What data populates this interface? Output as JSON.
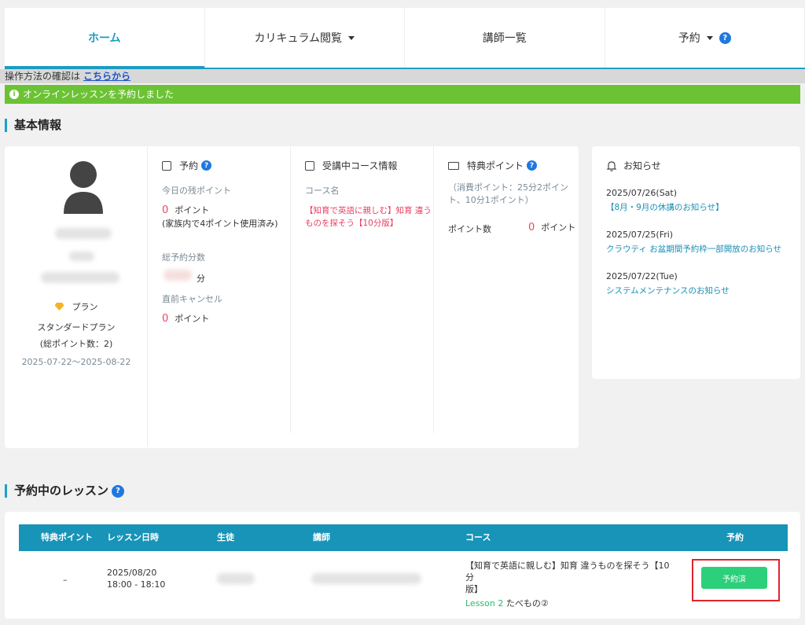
{
  "nav": {
    "home": "ホーム",
    "curriculum": "カリキュラム閲覧",
    "teachers": "講師一覧",
    "reserve": "予約"
  },
  "howto": {
    "text": "操作方法の確認は",
    "link": "こちらから"
  },
  "success_message": "オンラインレッスンを予約しました",
  "basic_info_title": "基本情報",
  "profile": {
    "plan_label": "プラン",
    "plan_name": "スタンダードプラン",
    "total_points": "(総ポイント数：2)",
    "period": "2025-07-22〜2025-08-22"
  },
  "reservation": {
    "title": "予約",
    "remaining_label": "今日の残ポイント",
    "remaining_value": "0",
    "point_unit": "ポイント",
    "family_note": "(家族内で4ポイント使用済み)",
    "total_minutes_label": "総予約分数",
    "minute_unit": "分",
    "cancel_label": "直前キャンセル",
    "cancel_value": "0",
    "cancel_unit": "ポイント"
  },
  "course": {
    "title": "受講中コース情報",
    "name_label": "コース名",
    "name_line1": "【知育で英語に親しむ】知育 違う",
    "name_line2": "ものを探そう【10分版】"
  },
  "bonus": {
    "title": "特典ポイント",
    "note_line1": "（消費ポイント：25分2ポイン",
    "note_line2": "ト、10分1ポイント）",
    "points_label": "ポイント数",
    "points_value": "0",
    "points_unit": "ポイント"
  },
  "notices": {
    "title": "お知らせ",
    "items": [
      {
        "date": "2025/07/26(Sat)",
        "title": "【8月・9月の休講のお知らせ】"
      },
      {
        "date": "2025/07/25(Fri)",
        "title": "クラウティ お盆期間予約枠一部開放のお知らせ"
      },
      {
        "date": "2025/07/22(Tue)",
        "title": "システムメンテナンスのお知らせ"
      }
    ]
  },
  "lessons_title": "予約中のレッスン",
  "table": {
    "headers": {
      "bonus": "特典ポイント",
      "datetime": "レッスン日時",
      "student": "生徒",
      "teacher": "講師",
      "course": "コース",
      "reserve": "予約"
    },
    "row": {
      "bonus": "–",
      "date": "2025/08/20",
      "time": "18:00 - 18:10",
      "course_line1": "【知育で英語に親しむ】知育 違うものを探そう【10分",
      "course_line2": "版】",
      "lesson_link": "Lesson 2",
      "lesson_title": "たべもの②",
      "reserved_button": "予約済"
    }
  }
}
